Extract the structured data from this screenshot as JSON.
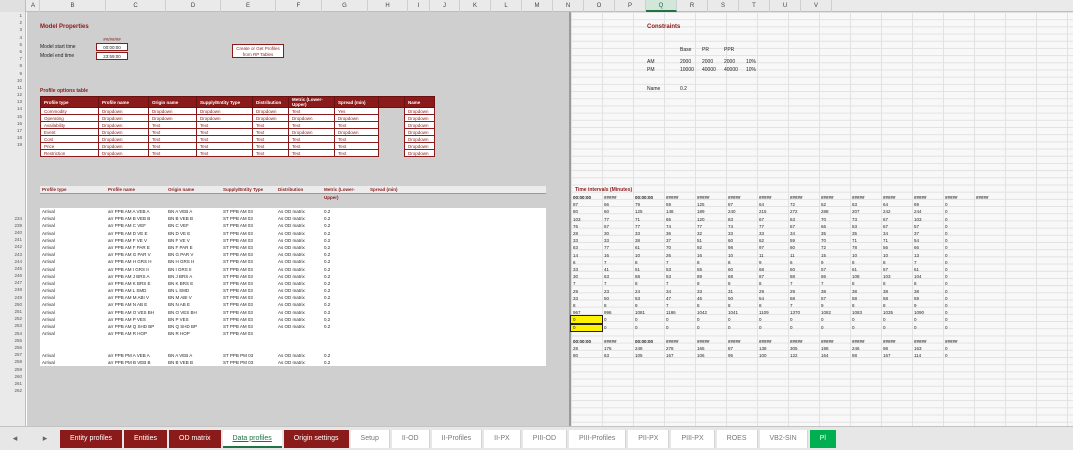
{
  "columns": [
    "A",
    "B",
    "C",
    "D",
    "E",
    "F",
    "G",
    "H",
    "I",
    "J",
    "K",
    "L",
    "M",
    "N",
    "O",
    "P",
    "Q",
    "R",
    "S",
    "T",
    "U",
    "V"
  ],
  "selected_column": "Q",
  "row_numbers": [
    "1",
    "2",
    "3",
    "4",
    "5",
    "6",
    "7",
    "8",
    "9",
    "10",
    "11",
    "12",
    "13",
    "14",
    "15",
    "16",
    "17",
    "18",
    "19",
    "234",
    "239",
    "240",
    "241",
    "242",
    "243",
    "244",
    "245",
    "246",
    "247",
    "248",
    "249",
    "250",
    "251",
    "252",
    "253",
    "254",
    "255",
    "256",
    "257",
    "258",
    "259",
    "260",
    "261",
    "262"
  ],
  "model": {
    "title": "Model Properties",
    "start_label": "Model start time",
    "end_label": "Model end time",
    "date_value": "##/##/##",
    "start_value": "00:00:00",
    "end_value": "23:59:00",
    "button_label": "Create or Get Profiles from RP Tables"
  },
  "profile_options": {
    "title": "Profile options table",
    "headers": [
      "Profile type",
      "Profile name",
      "Origin name",
      "Supply/Entity Type",
      "Distribution",
      "Metric (Lower-Upper)",
      "Spread (min)",
      "",
      "Name"
    ],
    "rows": [
      [
        "Commodity",
        "Dropdown",
        "Dropdown",
        "Dropdown",
        "Dropdown",
        "Text",
        "Yes",
        "",
        "Dropdown"
      ],
      [
        "Operating",
        "Dropdown",
        "Dropdown",
        "Dropdown",
        "Dropdown",
        "Dropdown",
        "Dropdown",
        "",
        "Dropdown"
      ],
      [
        "Availability",
        "Dropdown",
        "Text",
        "Text",
        "Text",
        "Text",
        "Text",
        "",
        "Dropdown"
      ],
      [
        "Event",
        "Dropdown",
        "Text",
        "Text",
        "Text",
        "Dropdown",
        "Dropdown",
        "",
        "Dropdown"
      ],
      [
        "Cost",
        "Dropdown",
        "Text",
        "Text",
        "Text",
        "Text",
        "Text",
        "",
        "Dropdown"
      ],
      [
        "Price",
        "Dropdown",
        "Text",
        "Text",
        "Text",
        "Text",
        "Text",
        "",
        "Dropdown"
      ],
      [
        "Restriction",
        "Dropdown",
        "Text",
        "Text",
        "Text",
        "Text",
        "Text",
        "",
        "Dropdown"
      ]
    ]
  },
  "constraints": {
    "title": "Constraints",
    "cols": [
      "Base",
      "PR",
      "PPR"
    ],
    "rows": [
      {
        "label": "AM",
        "values": [
          "2000",
          "2000",
          "2000",
          "10%"
        ]
      },
      {
        "label": "PM",
        "values": [
          "10000",
          "40000",
          "40000",
          "10%"
        ]
      }
    ],
    "note_label": "Name",
    "note_value": "0.2"
  },
  "data_profiles": {
    "headers": [
      "Profile type",
      "Profile name",
      "Origin name",
      "Supply/Entity Type",
      "Distribution",
      "Metric (Lower-Upper)",
      "Spread (min)"
    ],
    "rows": [
      [
        "Arrival",
        "arr PPB AM A VEB A",
        "BN A VEB A",
        "ST PPB AM 03",
        "As OD matrix",
        "0.2"
      ],
      [
        "Arrival",
        "arr PPB AM B VEB B",
        "BN B VEB B",
        "ST PPB AM 03",
        "As OD matrix",
        "0.2"
      ],
      [
        "Arrival",
        "arr PPB AM C VEF",
        "BN C VEF",
        "ST PPB AM 03",
        "As OD matrix",
        "0.2"
      ],
      [
        "Arrival",
        "arr PPB AM D VE E",
        "BN D VE E",
        "ST PPB AM 03",
        "As OD matrix",
        "0.2"
      ],
      [
        "Arrival",
        "arr PPB AM F VE V",
        "BN F VE V",
        "ST PPB AM 03",
        "As OD matrix",
        "0.2"
      ],
      [
        "Arrival",
        "arr PPB AM F PAR E",
        "BN F PAR E",
        "ST PPB AM 03",
        "As OD matrix",
        "0.2"
      ],
      [
        "Arrival",
        "arr PPB AM G PAR V",
        "BN G PAR V",
        "ST PPB AM 03",
        "As OD matrix",
        "0.2"
      ],
      [
        "Arrival",
        "arr PPB AM H GRS H",
        "BN H GRS H",
        "ST PPB AM 03",
        "As OD matrix",
        "0.2"
      ],
      [
        "Arrival",
        "arr PPB AM I GRS II",
        "BN I GRS II",
        "ST PPB AM 03",
        "As OD matrix",
        "0.2"
      ],
      [
        "Arrival",
        "arr PPB AM J BRS A",
        "BN J BRS A",
        "ST PPB AM 03",
        "As OD matrix",
        "0.2"
      ],
      [
        "Arrival",
        "arr PPB AM K BRS E",
        "BN K BRS E",
        "ST PPB AM 03",
        "As OD matrix",
        "0.2"
      ],
      [
        "Arrival",
        "arr PPB AM L SMD",
        "BN L SMD",
        "ST PPB AM 03",
        "As OD matrix",
        "0.2"
      ],
      [
        "Arrival",
        "arr PPB AM M ABI V",
        "BN M ABI V",
        "ST PPB AM 03",
        "As OD matrix",
        "0.2"
      ],
      [
        "Arrival",
        "arr PPB AM N AB E",
        "BN N AB E",
        "ST PPB AM 03",
        "As OD matrix",
        "0.2"
      ],
      [
        "Arrival",
        "arr PPB AM O VES BH",
        "BN O VES BH",
        "ST PPB AM 03",
        "As OD matrix",
        "0.2"
      ],
      [
        "Arrival",
        "arr PPB AM P VES",
        "BN P VES",
        "ST PPB AM 03",
        "As OD matrix",
        "0.2"
      ],
      [
        "Arrival",
        "arr PPB AM Q SHD BP",
        "BN Q SHD BP",
        "ST PPB AM 03",
        "As OD matrix",
        "0.2"
      ],
      [
        "Arrival",
        "arr PPB AM R HOP",
        "BN R HOP",
        "ST PPB AM 03",
        "",
        ""
      ],
      [
        "",
        "",
        "",
        "",
        "",
        ""
      ],
      [
        "",
        "",
        "",
        "",
        "",
        ""
      ],
      [
        "Arrival",
        "arr PPB PM A VEB A",
        "BN A VEB A",
        "ST PPB PM 03",
        "As OD matrix",
        "0.2"
      ],
      [
        "Arrival",
        "arr PPB PM B VEB B",
        "BN B VEB B",
        "ST PPB PM 03",
        "As OD matrix",
        "0.2"
      ]
    ]
  },
  "time_intervals": {
    "title": "Time intervals (Minutes)",
    "time_row": [
      "00:00:00",
      "#####",
      "00:00:00",
      "#####",
      "#####",
      "#####",
      "#####",
      "#####",
      "#####",
      "#####",
      "#####",
      "#####",
      "#####",
      "#####"
    ],
    "rows": [
      [
        "87",
        "66",
        "79",
        "59",
        "125",
        "87",
        "64",
        "72",
        "62",
        "63",
        "64",
        "69",
        "0"
      ],
      [
        "80",
        "60",
        "125",
        "148",
        "189",
        "240",
        "215",
        "272",
        "288",
        "207",
        "242",
        "244",
        "0"
      ],
      [
        "103",
        "77",
        "71",
        "65",
        "120",
        "83",
        "67",
        "63",
        "70",
        "73",
        "67",
        "103",
        "0"
      ],
      [
        "76",
        "57",
        "77",
        "74",
        "77",
        "74",
        "77",
        "67",
        "66",
        "53",
        "67",
        "57",
        "0"
      ],
      [
        "28",
        "30",
        "33",
        "36",
        "32",
        "33",
        "33",
        "34",
        "35",
        "35",
        "34",
        "37",
        "0"
      ],
      [
        "33",
        "33",
        "38",
        "37",
        "51",
        "60",
        "62",
        "59",
        "70",
        "71",
        "71",
        "54",
        "0"
      ],
      [
        "83",
        "77",
        "61",
        "70",
        "92",
        "98",
        "97",
        "60",
        "72",
        "78",
        "56",
        "66",
        "0"
      ],
      [
        "14",
        "16",
        "10",
        "26",
        "16",
        "10",
        "11",
        "11",
        "15",
        "10",
        "10",
        "13",
        "0"
      ],
      [
        "6",
        "7",
        "8",
        "7",
        "8",
        "8",
        "9",
        "6",
        "9",
        "8",
        "8",
        "7",
        "0"
      ],
      [
        "33",
        "41",
        "51",
        "53",
        "55",
        "60",
        "68",
        "60",
        "57",
        "61",
        "57",
        "61",
        "0"
      ],
      [
        "30",
        "63",
        "68",
        "53",
        "89",
        "68",
        "87",
        "88",
        "86",
        "108",
        "103",
        "104",
        "0"
      ],
      [
        "7",
        "7",
        "8",
        "7",
        "8",
        "8",
        "8",
        "7",
        "7",
        "8",
        "8",
        "8",
        "0"
      ],
      [
        "29",
        "23",
        "24",
        "34",
        "33",
        "31",
        "29",
        "29",
        "38",
        "38",
        "38",
        "38",
        "0"
      ],
      [
        "33",
        "50",
        "53",
        "47",
        "45",
        "50",
        "54",
        "68",
        "57",
        "58",
        "58",
        "59",
        "0"
      ],
      [
        "8",
        "8",
        "9",
        "7",
        "8",
        "8",
        "8",
        "7",
        "9",
        "8",
        "8",
        "9",
        "0"
      ],
      [
        "967",
        "996",
        "1081",
        "1186",
        "1042",
        "1041",
        "1109",
        "1370",
        "1082",
        "1083",
        "1035",
        "1090",
        "0"
      ],
      [
        "0",
        "0",
        "0",
        "0",
        "0",
        "0",
        "0",
        "0",
        "0",
        "0",
        "0",
        "0",
        "0"
      ],
      [
        "0",
        "0",
        "0",
        "0",
        "0",
        "0",
        "0",
        "0",
        "0",
        "0",
        "0",
        "0",
        "0"
      ],
      [
        "",
        "",
        "",
        "",
        "",
        "",
        "",
        "",
        "",
        "",
        "",
        "",
        ""
      ],
      [
        "00:00:00",
        "#####",
        "00:00:00",
        "#####",
        "#####",
        "#####",
        "#####",
        "#####",
        "#####",
        "#####",
        "#####",
        "#####",
        "#####"
      ],
      [
        "28",
        "176",
        "248",
        "278",
        "165",
        "87",
        "138",
        "305",
        "198",
        "246",
        "98",
        "163",
        "0"
      ],
      [
        "80",
        "63",
        "105",
        "167",
        "106",
        "95",
        "100",
        "122",
        "164",
        "88",
        "167",
        "114",
        "0"
      ]
    ]
  },
  "sheet_tabs": [
    {
      "label": "Entity profiles",
      "style": "red"
    },
    {
      "label": "Entities",
      "style": "red"
    },
    {
      "label": "OD matrix",
      "style": "red"
    },
    {
      "label": "Data profiles",
      "style": "active"
    },
    {
      "label": "Origin settings",
      "style": "red"
    },
    {
      "label": "Setup",
      "style": "plain"
    },
    {
      "label": "II-OD",
      "style": "plain"
    },
    {
      "label": "II-Profiles",
      "style": "plain"
    },
    {
      "label": "II-PX",
      "style": "plain"
    },
    {
      "label": "PIII-OD",
      "style": "plain"
    },
    {
      "label": "PIII-Profiles",
      "style": "plain"
    },
    {
      "label": "PII-PX",
      "style": "plain"
    },
    {
      "label": "PIII-PX",
      "style": "plain"
    },
    {
      "label": "ROES",
      "style": "plain"
    },
    {
      "label": "VB2-SIN",
      "style": "plain"
    },
    {
      "label": "Pl",
      "style": "green"
    }
  ],
  "icons": {
    "tab_prev": "◂",
    "tab_next": "▸"
  }
}
